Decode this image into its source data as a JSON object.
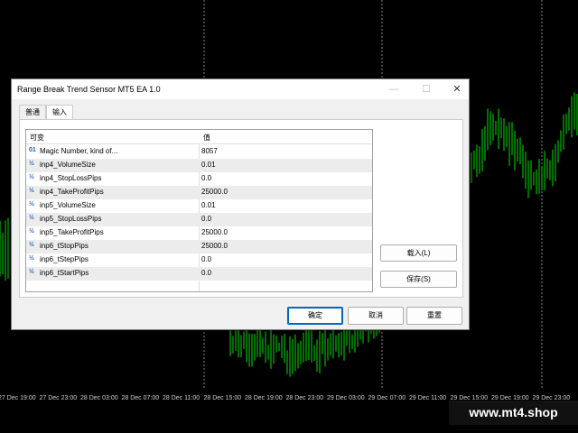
{
  "chart": {
    "x_labels": [
      "27 Dec 19:00",
      "27 Dec 23:00",
      "28 Dec 03:00",
      "28 Dec 07:00",
      "28 Dec 11:00",
      "28 Dec 15:00",
      "28 Dec 19:00",
      "28 Dec 23:00",
      "29 Dec 03:00",
      "29 Dec 07:00",
      "29 Dec 11:00",
      "29 Dec 15:00",
      "29 Dec 19:00",
      "29 Dec 23:00"
    ],
    "candle_color": "#00e000",
    "background": "#000000",
    "watermark": "www.mt4.shop"
  },
  "dialog": {
    "title": "Range Break Trend Sensor MT5 EA 1.0",
    "controls": {
      "minimize": "—",
      "maximize": "☐",
      "close": "✕"
    },
    "tabs": [
      {
        "label": "普通",
        "active": false
      },
      {
        "label": "输入",
        "active": true
      }
    ],
    "grid": {
      "headers": {
        "variable": "可变",
        "value": "值"
      },
      "rows": [
        {
          "icon": "01",
          "name": "Magic Number, kind of...",
          "value": "8057"
        },
        {
          "icon": "½",
          "name": "inp4_VolumeSize",
          "value": "0.01"
        },
        {
          "icon": "½",
          "name": "inp4_StopLossPips",
          "value": "0.0"
        },
        {
          "icon": "½",
          "name": "inp4_TakeProfitPips",
          "value": "25000.0"
        },
        {
          "icon": "½",
          "name": "inp5_VolumeSize",
          "value": "0.01"
        },
        {
          "icon": "½",
          "name": "inp5_StopLossPips",
          "value": "0.0"
        },
        {
          "icon": "½",
          "name": "inp5_TakeProfitPips",
          "value": "25000.0"
        },
        {
          "icon": "½",
          "name": "inp6_tStopPips",
          "value": "25000.0"
        },
        {
          "icon": "½",
          "name": "inp6_tStepPips",
          "value": "0.0"
        },
        {
          "icon": "½",
          "name": "inp6_tStartPips",
          "value": "0.0"
        }
      ]
    },
    "side_buttons": {
      "load": "载入(L)",
      "save": "保存(S)"
    },
    "footer_buttons": {
      "ok": "确定",
      "cancel": "取消",
      "reset": "重置"
    }
  }
}
